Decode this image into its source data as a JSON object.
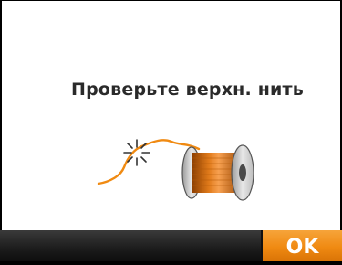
{
  "dialog": {
    "message": "Проверьте верхн. нить",
    "warning_icon": "exclamation-icon",
    "illustration_icon": "thread-spool-icon",
    "accent_color": "#f08a12"
  },
  "buttons": {
    "ok_label": "OK"
  }
}
